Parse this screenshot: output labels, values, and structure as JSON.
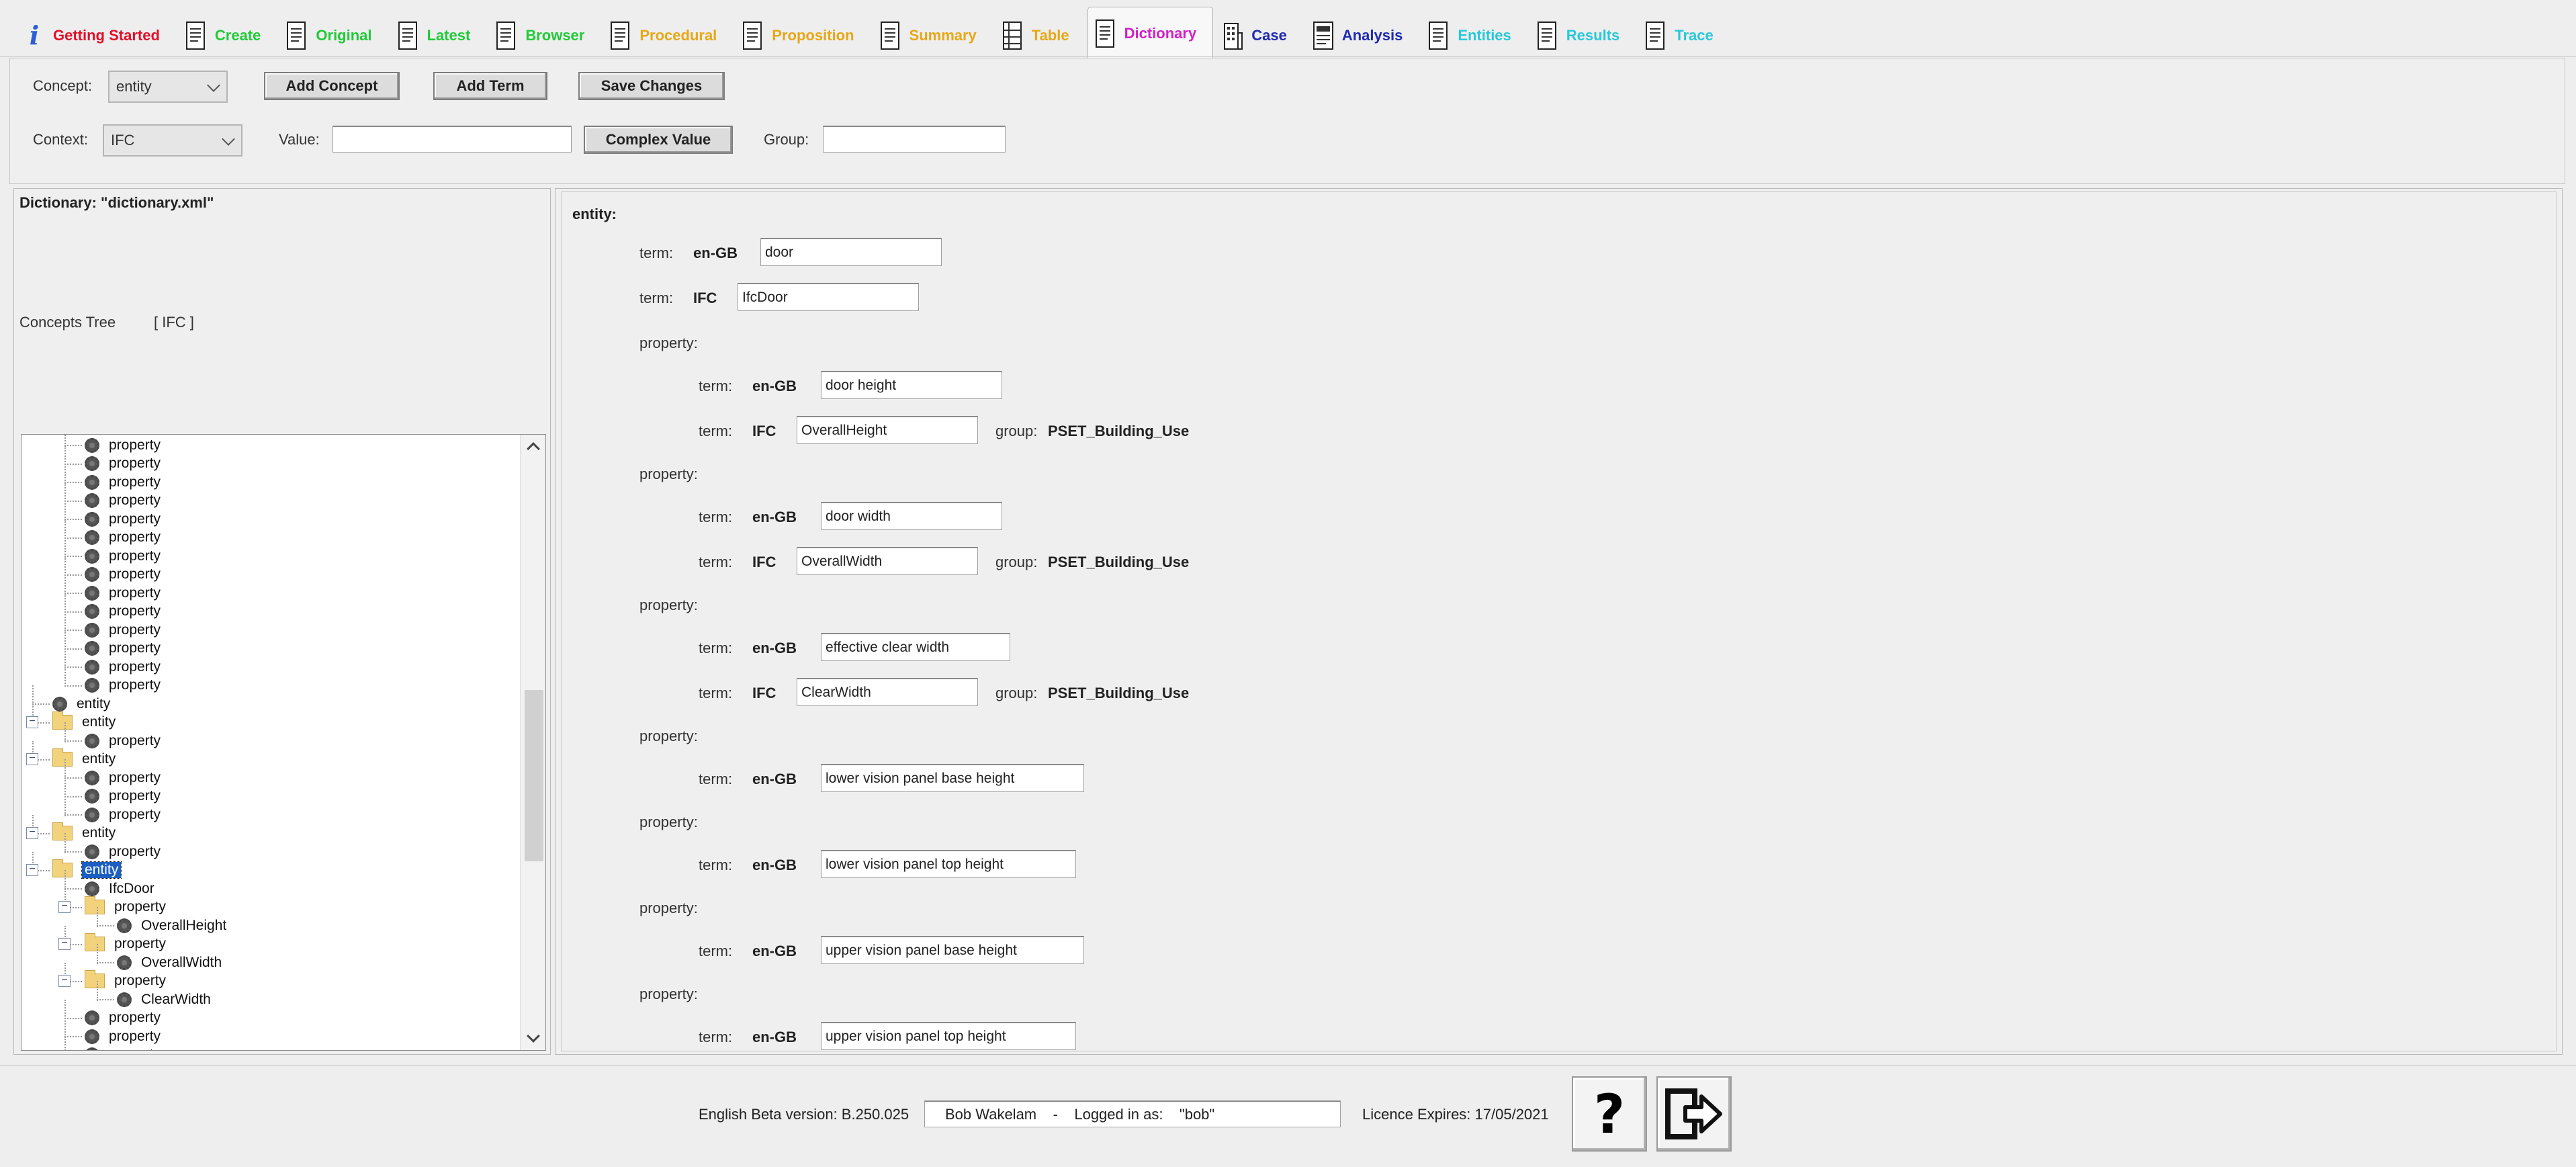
{
  "tabs": [
    {
      "label": "Getting Started",
      "color": "#e0102a",
      "icon": "info-icon"
    },
    {
      "label": "Create",
      "color": "#22c93a",
      "icon": "document-icon"
    },
    {
      "label": "Original",
      "color": "#22c93a",
      "icon": "document-icon"
    },
    {
      "label": "Latest",
      "color": "#22c93a",
      "icon": "document-icon"
    },
    {
      "label": "Browser",
      "color": "#22c93a",
      "icon": "document-icon"
    },
    {
      "label": "Procedural",
      "color": "#e6a817",
      "icon": "document-icon"
    },
    {
      "label": "Proposition",
      "color": "#e6a817",
      "icon": "document-icon"
    },
    {
      "label": "Summary",
      "color": "#e6a817",
      "icon": "document-icon"
    },
    {
      "label": "Table",
      "color": "#e6a817",
      "icon": "table-icon"
    },
    {
      "label": "Dictionary",
      "color": "#d21fc9",
      "icon": "document-icon",
      "active": true
    },
    {
      "label": "Case",
      "color": "#1f2bb0",
      "icon": "building-icon"
    },
    {
      "label": "Analysis",
      "color": "#1f2bb0",
      "icon": "report-icon"
    },
    {
      "label": "Entities",
      "color": "#29c8d8",
      "icon": "document-icon"
    },
    {
      "label": "Results",
      "color": "#29c8d8",
      "icon": "document-icon"
    },
    {
      "label": "Trace",
      "color": "#29c8d8",
      "icon": "document-icon"
    }
  ],
  "toolbar": {
    "concept_label": "Concept:",
    "concept_value": "entity",
    "add_concept": "Add Concept",
    "add_term": "Add Term",
    "save_changes": "Save Changes",
    "context_label": "Context:",
    "context_value": "IFC",
    "value_label": "Value:",
    "complex_value": "Complex Value",
    "group_label": "Group:"
  },
  "left": {
    "dictionary_label": "Dictionary:  \"dictionary.xml\"",
    "concepts_tree_label": "Concepts Tree",
    "concepts_tree_context": "[ IFC ]"
  },
  "tree": {
    "nodes": [
      {
        "label": "property",
        "kind": "leaf",
        "depth": 2
      },
      {
        "label": "property",
        "kind": "leaf",
        "depth": 2
      },
      {
        "label": "property",
        "kind": "leaf",
        "depth": 2
      },
      {
        "label": "property",
        "kind": "leaf",
        "depth": 2
      },
      {
        "label": "property",
        "kind": "leaf",
        "depth": 2
      },
      {
        "label": "property",
        "kind": "leaf",
        "depth": 2
      },
      {
        "label": "property",
        "kind": "leaf",
        "depth": 2
      },
      {
        "label": "property",
        "kind": "leaf",
        "depth": 2
      },
      {
        "label": "property",
        "kind": "leaf",
        "depth": 2
      },
      {
        "label": "property",
        "kind": "leaf",
        "depth": 2
      },
      {
        "label": "property",
        "kind": "leaf",
        "depth": 2
      },
      {
        "label": "property",
        "kind": "leaf",
        "depth": 2
      },
      {
        "label": "property",
        "kind": "leaf",
        "depth": 2
      },
      {
        "label": "property",
        "kind": "leaf",
        "depth": 2
      },
      {
        "label": "entity",
        "kind": "leaf",
        "depth": 1
      },
      {
        "label": "entity",
        "kind": "folder",
        "depth": 1
      },
      {
        "label": "property",
        "kind": "leaf",
        "depth": 2
      },
      {
        "label": "entity",
        "kind": "folder",
        "depth": 1
      },
      {
        "label": "property",
        "kind": "leaf",
        "depth": 2
      },
      {
        "label": "property",
        "kind": "leaf",
        "depth": 2
      },
      {
        "label": "property",
        "kind": "leaf",
        "depth": 2
      },
      {
        "label": "entity",
        "kind": "folder",
        "depth": 1
      },
      {
        "label": "property",
        "kind": "leaf",
        "depth": 2
      },
      {
        "label": "entity",
        "kind": "folder",
        "depth": 1,
        "selected": true
      },
      {
        "label": "IfcDoor",
        "kind": "leaf",
        "depth": 2
      },
      {
        "label": "property",
        "kind": "folder",
        "depth": 2
      },
      {
        "label": "OverallHeight",
        "kind": "leaf",
        "depth": 3
      },
      {
        "label": "property",
        "kind": "folder",
        "depth": 2
      },
      {
        "label": "OverallWidth",
        "kind": "leaf",
        "depth": 3
      },
      {
        "label": "property",
        "kind": "folder",
        "depth": 2
      },
      {
        "label": "ClearWidth",
        "kind": "leaf",
        "depth": 3
      },
      {
        "label": "property",
        "kind": "leaf",
        "depth": 2
      },
      {
        "label": "property",
        "kind": "leaf",
        "depth": 2
      },
      {
        "label": "property",
        "kind": "leaf",
        "depth": 2
      }
    ]
  },
  "detail": {
    "heading": "entity:",
    "term_label": "term:",
    "property_label": "property:",
    "group_label": "group:",
    "entity_terms": [
      {
        "lang": "en-GB",
        "value": "door"
      },
      {
        "lang": "IFC",
        "value": "IfcDoor"
      }
    ],
    "properties": [
      {
        "terms": [
          {
            "lang": "en-GB",
            "value": "door height"
          },
          {
            "lang": "IFC",
            "value": "OverallHeight",
            "group": "PSET_Building_Use"
          }
        ]
      },
      {
        "terms": [
          {
            "lang": "en-GB",
            "value": "door width"
          },
          {
            "lang": "IFC",
            "value": "OverallWidth",
            "group": "PSET_Building_Use"
          }
        ]
      },
      {
        "terms": [
          {
            "lang": "en-GB",
            "value": "effective clear width"
          },
          {
            "lang": "IFC",
            "value": "ClearWidth",
            "group": "PSET_Building_Use"
          }
        ]
      },
      {
        "terms": [
          {
            "lang": "en-GB",
            "value": "lower vision panel base height"
          }
        ]
      },
      {
        "terms": [
          {
            "lang": "en-GB",
            "value": "lower vision panel top height"
          }
        ]
      },
      {
        "terms": [
          {
            "lang": "en-GB",
            "value": "upper vision panel base height"
          }
        ]
      },
      {
        "terms": [
          {
            "lang": "en-GB",
            "value": "upper vision panel top height"
          }
        ]
      }
    ]
  },
  "status": {
    "version": "English Beta version: B.250.025",
    "user": "Bob Wakelam    -    Logged in as:    \"bob\"",
    "licence": "Licence Expires: 17/05/2021"
  },
  "buttons": {
    "help_glyph": "?"
  }
}
